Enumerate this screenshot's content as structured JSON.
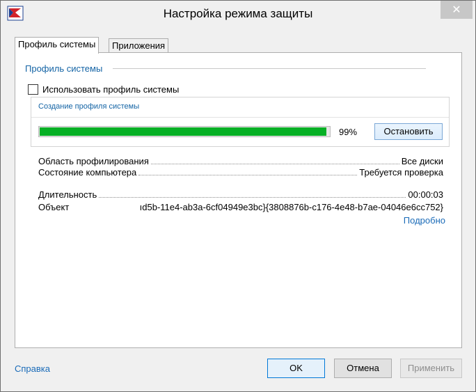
{
  "window": {
    "title": "Настройка режима защиты"
  },
  "tabs": [
    {
      "label": "Профиль системы",
      "active": true
    },
    {
      "label": "Приложения",
      "active": false
    }
  ],
  "section": {
    "title": "Профиль системы"
  },
  "use_profile": {
    "label": "Использовать профиль системы",
    "checked": false
  },
  "creation": {
    "title": "Создание профиля системы",
    "progress_percent": 99,
    "percent_text": "99%",
    "stop_label": "Остановить"
  },
  "details": [
    {
      "label": "Область профилирования",
      "value": "Все диски"
    },
    {
      "label": "Состояние компьютера",
      "value": "Требуется проверка"
    },
    {
      "label": "Длительность",
      "value": "00:00:03"
    }
  ],
  "object": {
    "label": "Объект",
    "value": "ıd5b-11e4-ab3a-6cf04949e3bc}{3808876b-c176-4e48-b7ae-04046e6cc752}"
  },
  "more_link": "Подробно",
  "footer": {
    "help": "Справка",
    "ok": "OK",
    "cancel": "Отмена",
    "apply": "Применить"
  },
  "colors": {
    "progress": "#06b025",
    "link": "#1a6bb8",
    "section_title": "#1464a5"
  }
}
